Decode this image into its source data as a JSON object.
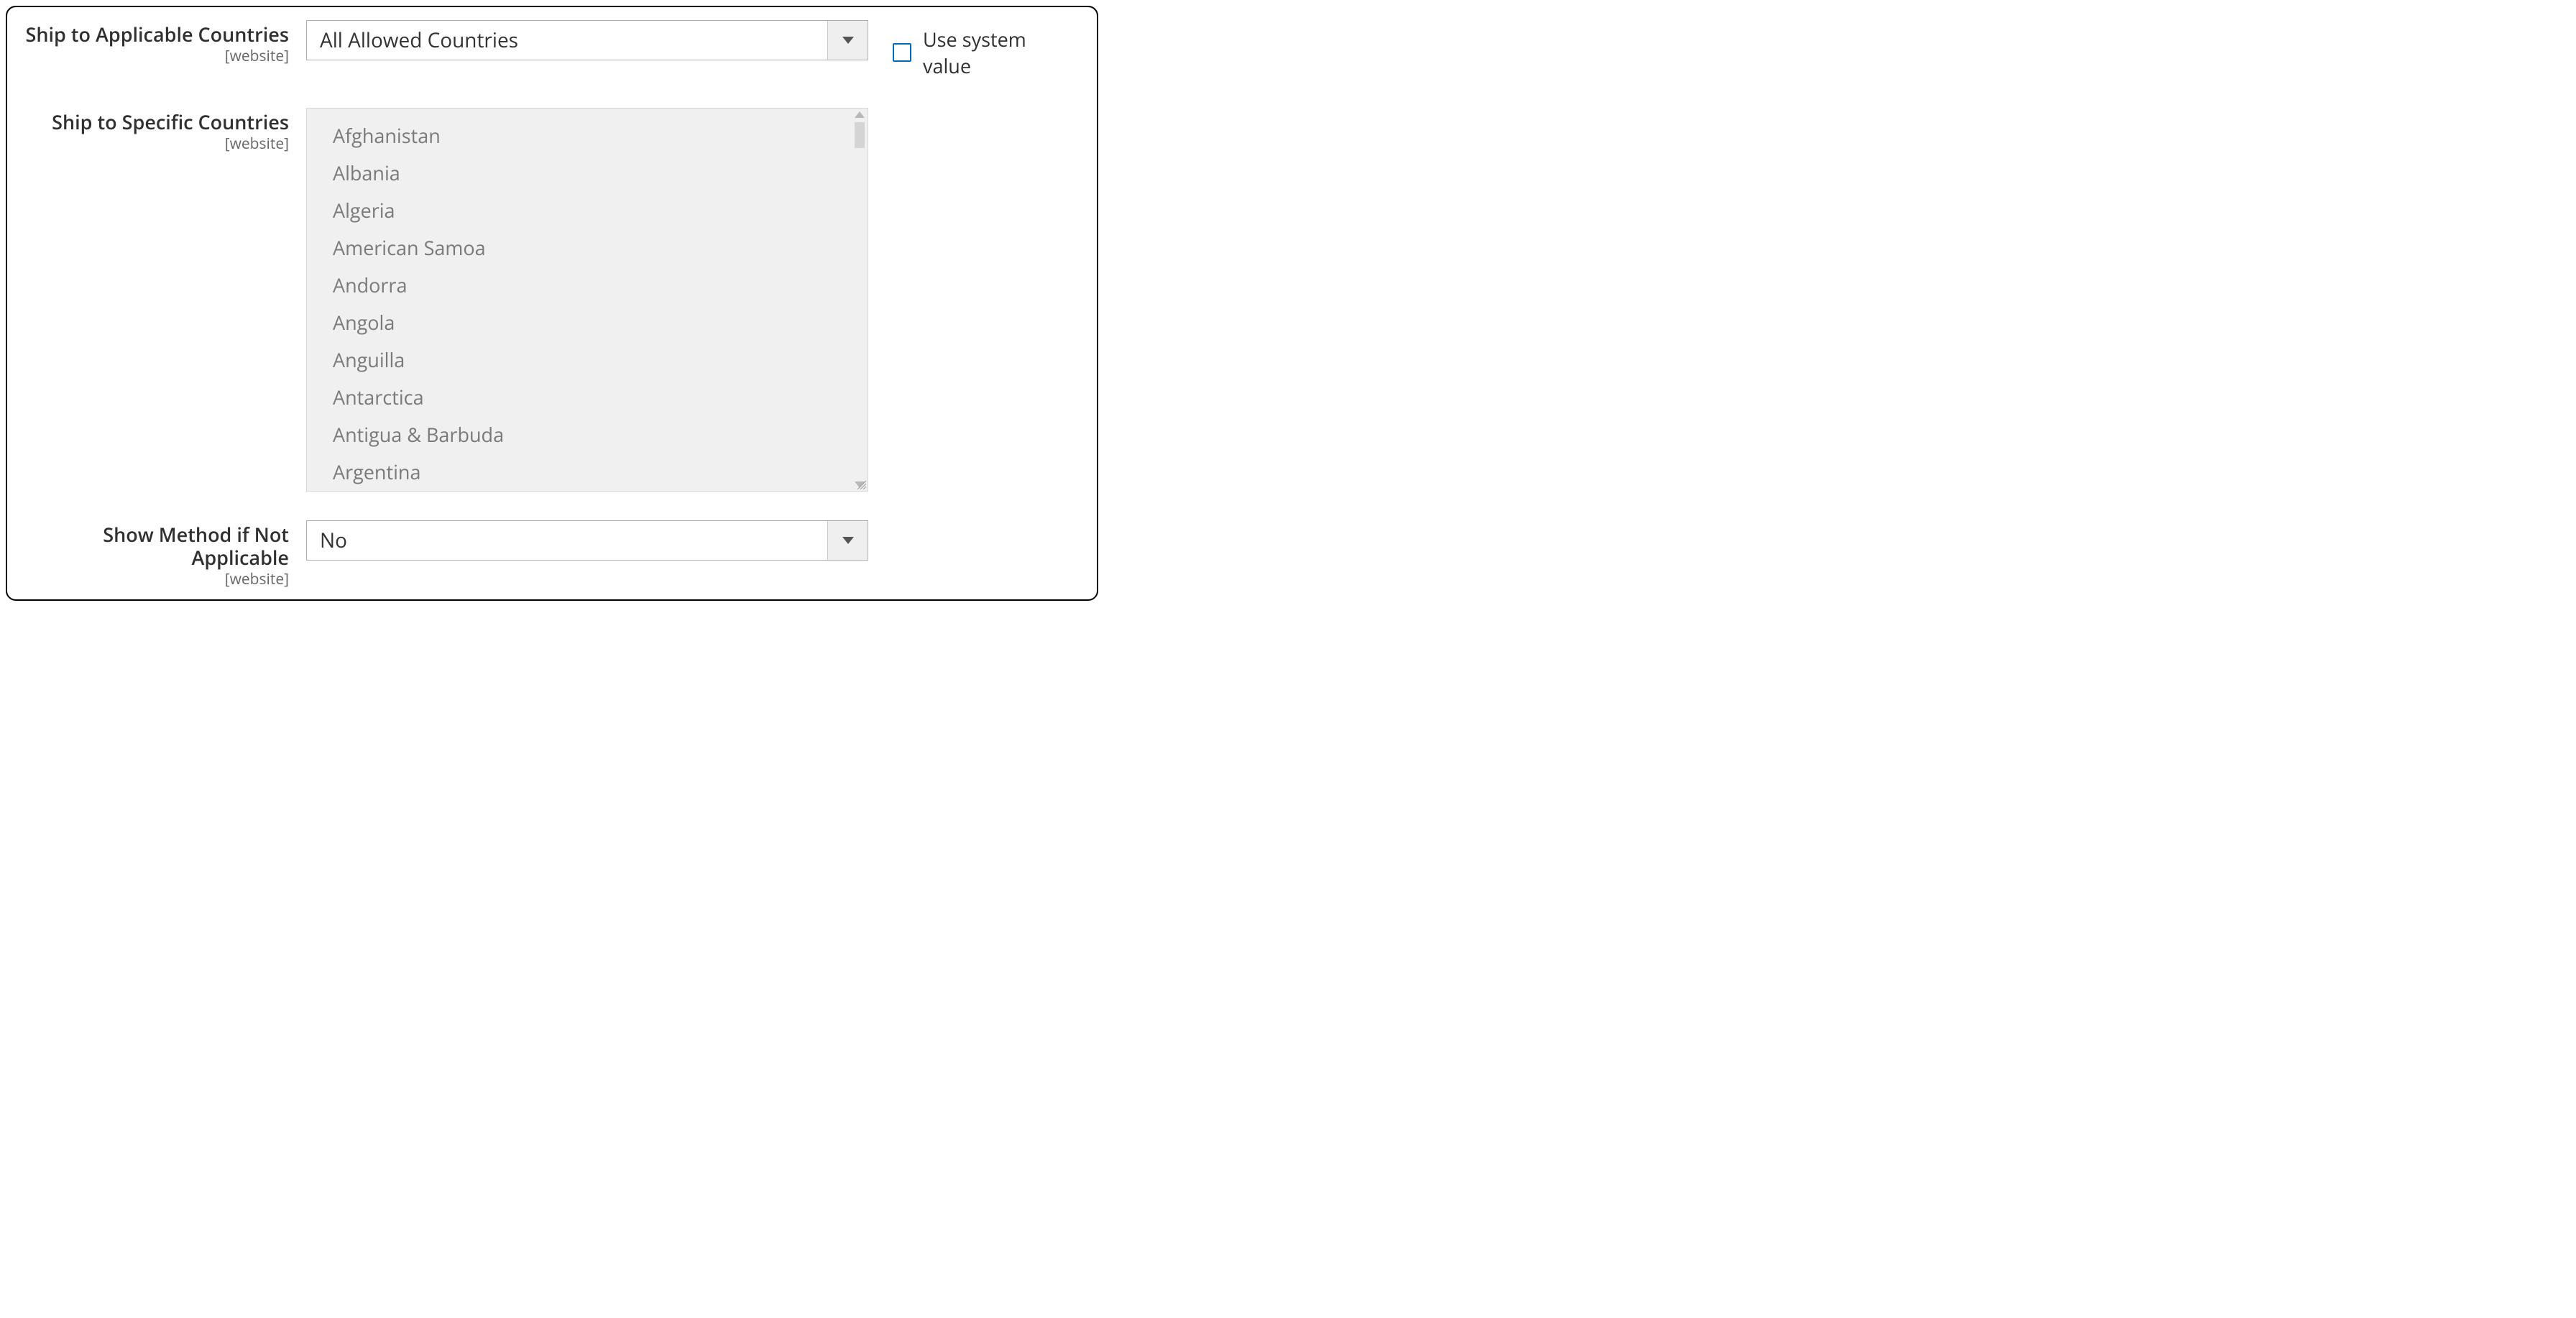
{
  "fields": {
    "ship_applicable": {
      "label": "Ship to Applicable Countries",
      "scope": "[website]",
      "value": "All Allowed Countries",
      "use_system_label": "Use system value"
    },
    "ship_specific": {
      "label": "Ship to Specific Countries",
      "scope": "[website]",
      "options": [
        "Afghanistan",
        "Albania",
        "Algeria",
        "American Samoa",
        "Andorra",
        "Angola",
        "Anguilla",
        "Antarctica",
        "Antigua & Barbuda",
        "Argentina"
      ]
    },
    "show_method": {
      "label": "Show Method if Not Applicable",
      "scope": "[website]",
      "value": "No"
    }
  }
}
